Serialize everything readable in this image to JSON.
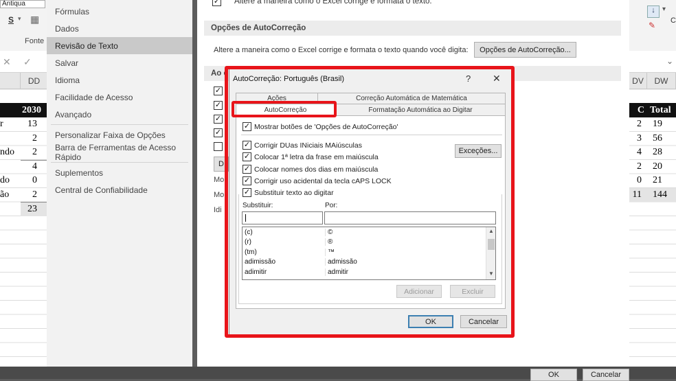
{
  "excel": {
    "ribbon_left": {
      "font_name": "Antiqua",
      "group_label": "Fonte"
    },
    "ribbon_right": {
      "label": "Cl"
    },
    "col_left": "DD",
    "col_right": [
      "DV",
      "DW"
    ],
    "header_left": "2030",
    "header_right": [
      "C",
      "Total"
    ],
    "rows_left": [
      {
        "text": "r",
        "num": "13"
      },
      {
        "text": "",
        "num": "2"
      },
      {
        "text": "ndo",
        "num": "2"
      },
      {
        "text": "",
        "num": "4"
      },
      {
        "text": "do",
        "num": "0"
      },
      {
        "text": "ão",
        "num": "2"
      },
      {
        "text": "",
        "num": "23"
      }
    ],
    "rows_right": [
      {
        "a": "2",
        "b": "19"
      },
      {
        "a": "3",
        "b": "56"
      },
      {
        "a": "4",
        "b": "28"
      },
      {
        "a": "2",
        "b": "20"
      },
      {
        "a": "0",
        "b": "21"
      },
      {
        "a": "11",
        "b": "144"
      }
    ]
  },
  "options_nav": {
    "items": [
      "Fórmulas",
      "Dados",
      "Revisão de Texto",
      "Salvar",
      "Idioma",
      "Facilidade de Acesso",
      "Avançado",
      "Personalizar Faixa de Opções",
      "Barra de Ferramentas de Acesso Rápido",
      "Suplementos",
      "Central de Confiabilidade"
    ],
    "selected": "Revisão de Texto"
  },
  "options_main": {
    "top_text": "Altere a maneira como o Excel corrige e formata o texto.",
    "section1_title": "Opções de AutoCorreção",
    "section1_desc": "Altere a maneira como o Excel corrige e formata o texto quando você digita:",
    "autocorrect_button": "Opções de AutoCorreção...",
    "section2_title": "Ao c",
    "partial_labels": [
      "D",
      "Mo",
      "Mo",
      "Idi"
    ],
    "ok": "OK",
    "cancel": "Cancelar"
  },
  "dialog": {
    "title": "AutoCorreção: Português (Brasil)",
    "help": "?",
    "close": "✕",
    "tabs_row1": [
      "Ações",
      "Correção Automática de Matemática"
    ],
    "tabs_row2": [
      "AutoCorreção",
      "Formatação Automática ao Digitar"
    ],
    "show_buttons": "Mostrar botões de 'Opções de AutoCorreção'",
    "options": [
      "Corrigir DUas INiciais MAiúsculas",
      "Colocar 1ª letra da frase em maiúscula",
      "Colocar nomes dos dias em maiúscula",
      "Corrigir uso acidental da tecla cAPS LOCK",
      "Substituir texto ao digitar"
    ],
    "exceptions_button": "Exceções...",
    "replace_label": "Substituir:",
    "with_label": "Por:",
    "list": [
      {
        "from": "(c)",
        "to": "©"
      },
      {
        "from": "(r)",
        "to": "®"
      },
      {
        "from": "(tm)",
        "to": "™"
      },
      {
        "from": "adimissão",
        "to": "admissão"
      },
      {
        "from": "adimitir",
        "to": "admitir"
      }
    ],
    "add_button": "Adicionar",
    "delete_button": "Excluir",
    "ok": "OK",
    "cancel": "Cancelar"
  },
  "colors": {
    "highlight": "#e8141a"
  }
}
